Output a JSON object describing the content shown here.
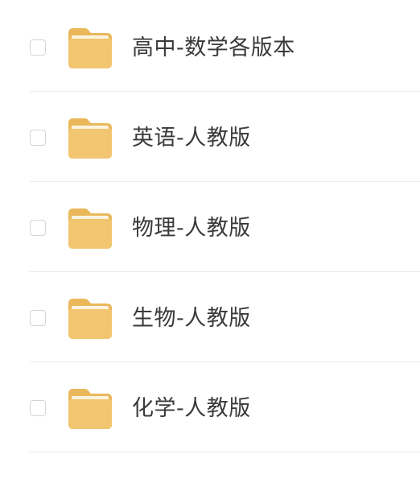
{
  "colors": {
    "folder_body": "#f2c570",
    "folder_back": "#eab85a",
    "folder_sheet": "#fbf3df",
    "text": "#3a3a3d",
    "checkbox_border": "#d4d4d8",
    "divider": "#ececee"
  },
  "files": {
    "items": [
      {
        "name": "高中-数学各版本",
        "icon": "folder-icon",
        "checked": false
      },
      {
        "name": "英语-人教版",
        "icon": "folder-icon",
        "checked": false
      },
      {
        "name": "物理-人教版",
        "icon": "folder-icon",
        "checked": false
      },
      {
        "name": "生物-人教版",
        "icon": "folder-icon",
        "checked": false
      },
      {
        "name": "化学-人教版",
        "icon": "folder-icon",
        "checked": false
      }
    ]
  }
}
